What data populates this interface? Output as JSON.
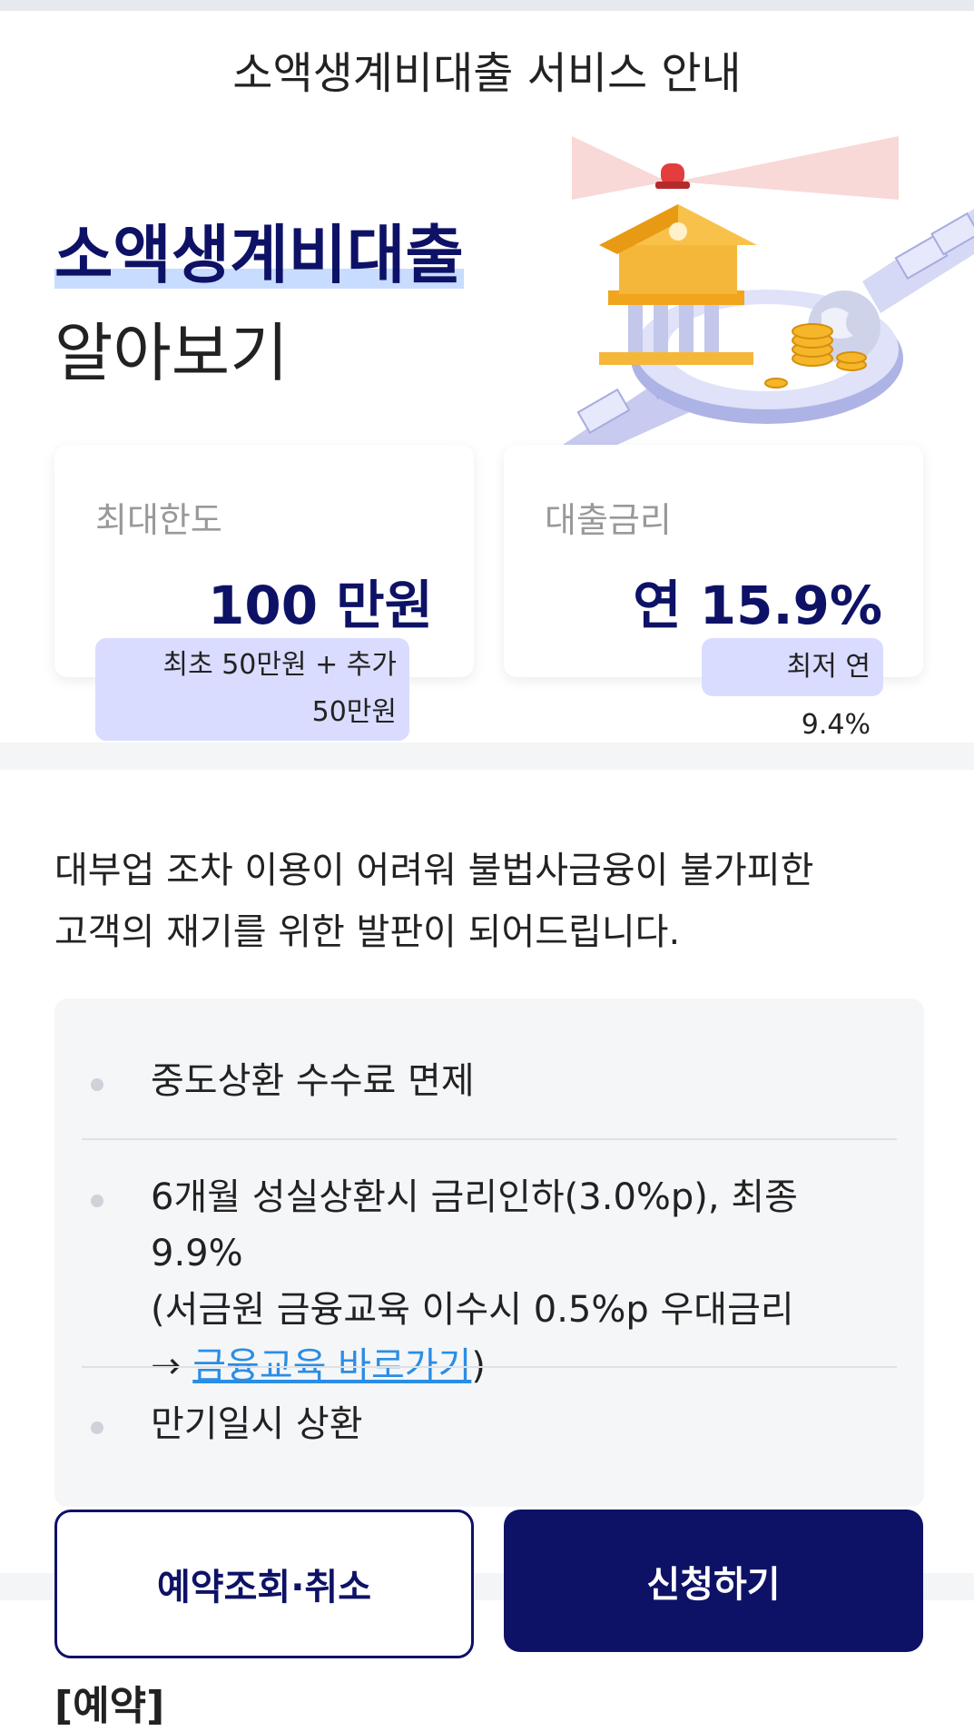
{
  "header": {
    "title": "소액생계비대출 서비스 안내"
  },
  "hero": {
    "title": "소액생계비대출",
    "subtitle": "알아보기"
  },
  "cards": [
    {
      "label": "최대한도",
      "value": "100 만원",
      "badge_line1": "최초 50만원 + 추가",
      "badge_line2": "50만원"
    },
    {
      "label": "대출금리",
      "value": "연 15.9%",
      "badge_line1": "최저 연 9.4%"
    }
  ],
  "description": {
    "line1": "대부업 조차 이용이 어려워 불법사금융이 불가피한",
    "line2": "고객의 재기를 위한 발판이 되어드립니다."
  },
  "info": {
    "item1": "중도상환 수수료 면제",
    "item2_line1": "6개월 성실상환시 금리인하(3.0%p), 최종 9.9%",
    "item2_line2": "(서금원 금융교육 이수시 0.5%p 우대금리",
    "item2_arrow": "→ ",
    "item2_link": "금융교육 바로가기",
    "item2_close": ")",
    "item3": "만기일시 상환"
  },
  "buttons": {
    "reserve": "예약조회·취소",
    "apply": "신청하기"
  },
  "footer_cut": "[예약]",
  "colors": {
    "navy": "#0e1266",
    "highlight": "#c7dcff",
    "badge": "#d9dcff",
    "link": "#2a8de6"
  },
  "icons": [
    "bank-building-icon",
    "alarm-light-icon",
    "coins-icon",
    "globe-icon"
  ]
}
